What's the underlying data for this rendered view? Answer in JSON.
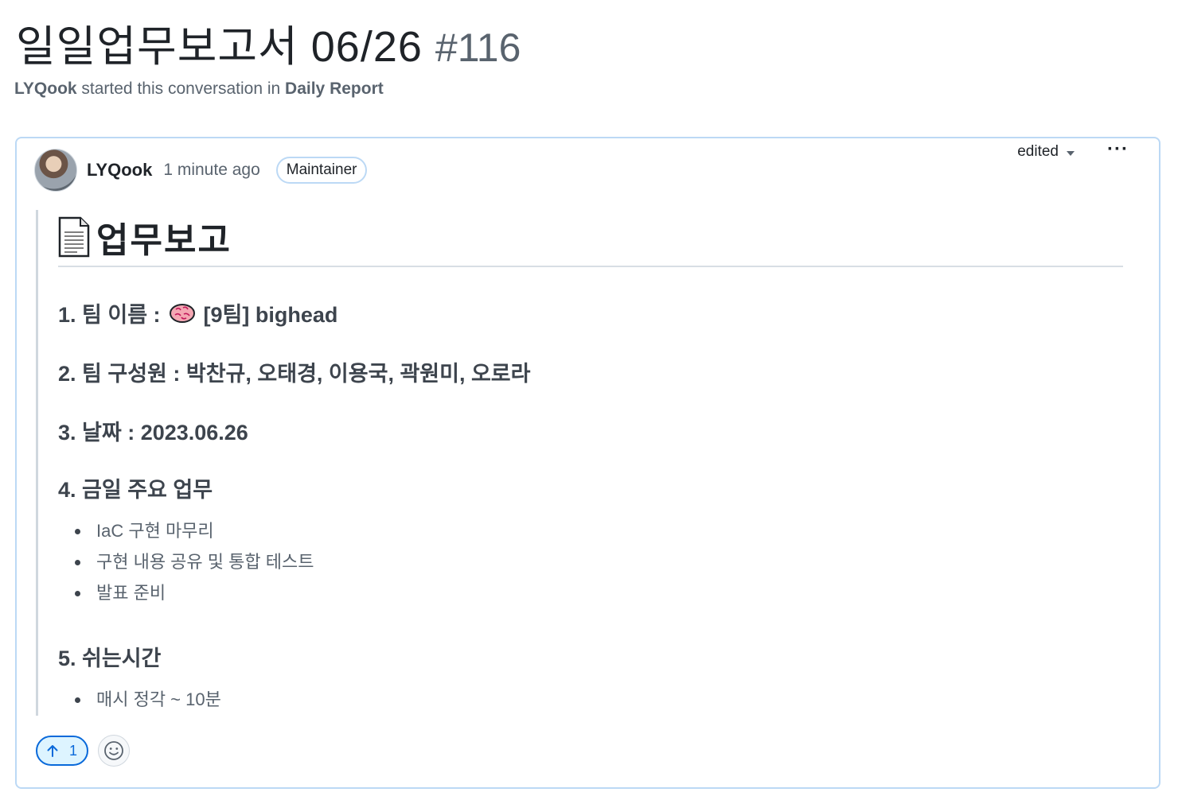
{
  "discussion": {
    "title": "일일업무보고서 06/26",
    "number": "#116",
    "subtitle": {
      "author": "LYQook",
      "middle": " started this conversation in ",
      "category": "Daily Report"
    }
  },
  "comment": {
    "author": "LYQook",
    "time": "1 minute ago",
    "role_badge": "Maintainer",
    "edited_label": "edited",
    "more_label": "···",
    "heading": "업무보고",
    "sections": [
      {
        "prefix": "1. 팀 이름 :",
        "suffix": "[9팀] bighead"
      },
      {
        "text": "2. 팀 구성원 : 박찬규, 오태경, 이용국, 곽원미, 오로라"
      },
      {
        "text": "3. 날짜 : 2023.06.26"
      },
      {
        "text": "4. 금일 주요 업무",
        "items": [
          "IaC 구현 마무리",
          "구현 내용 공유 및 통합 테스트",
          "발표 준비"
        ]
      },
      {
        "text": "5. 쉬는시간",
        "items": [
          "매시 정각 ~ 10분"
        ]
      }
    ],
    "reactions": {
      "upvote_count": "1"
    }
  },
  "colors": {
    "accent": "#0969da",
    "card_border": "#bcd9f5",
    "muted_text": "#59636e"
  },
  "icons": [
    "avatar",
    "document-icon",
    "brain-icon",
    "caret-down-icon",
    "arrow-up-icon",
    "smiley-icon"
  ]
}
